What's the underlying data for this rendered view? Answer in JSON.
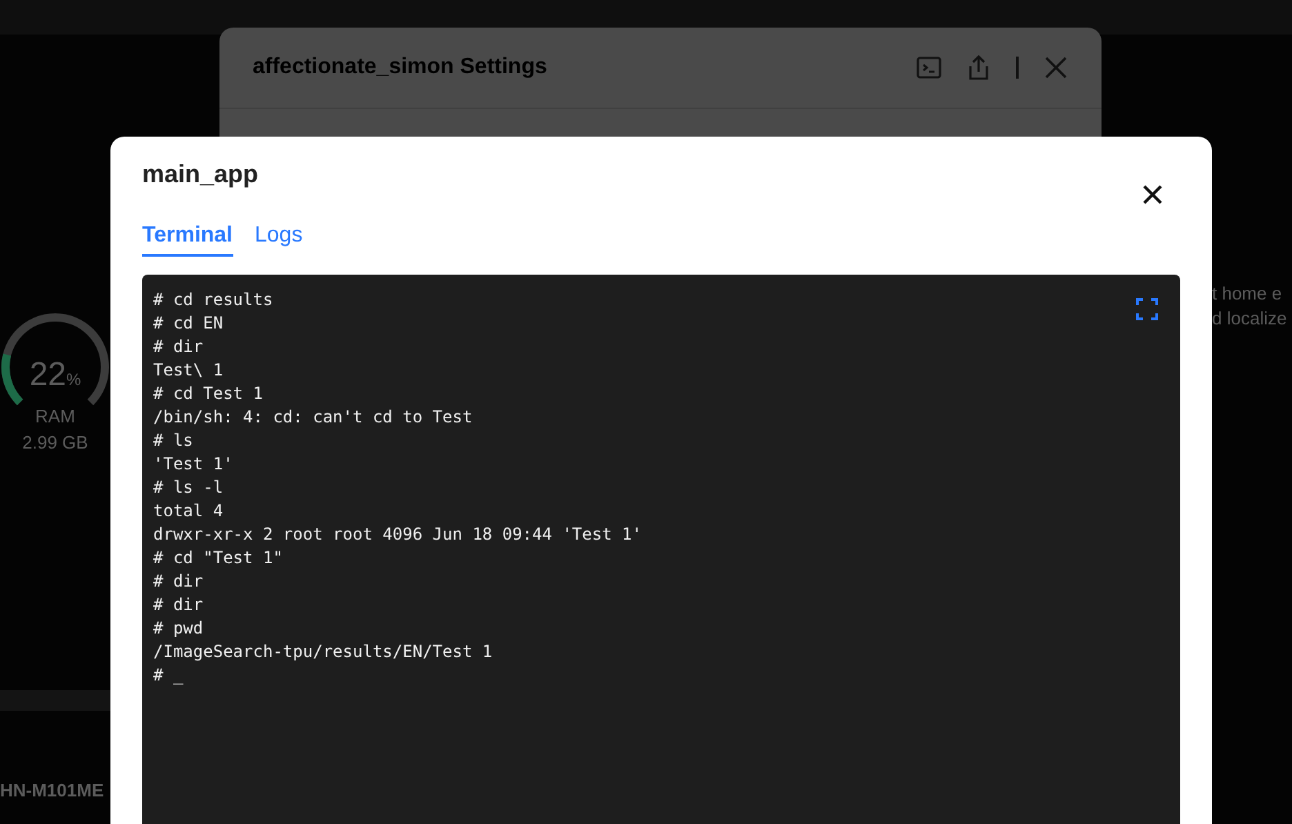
{
  "background": {
    "gauge": {
      "value": "22",
      "unit": "%",
      "label": "RAM",
      "amount": "2.99 GB"
    },
    "device_name": "HN-M101ME",
    "description_lines": [
      "t home e",
      "d localize"
    ]
  },
  "settings_dialog": {
    "title": "affectionate_simon Settings"
  },
  "dialog": {
    "title": "main_app",
    "tabs": [
      {
        "label": "Terminal",
        "selected": true
      },
      {
        "label": "Logs",
        "selected": false
      }
    ],
    "terminal_lines": [
      "# cd results",
      "# cd EN",
      "# dir",
      "Test\\ 1",
      "# cd Test 1",
      "/bin/sh: 4: cd: can't cd to Test",
      "# ls",
      "'Test 1'",
      "# ls -l",
      "total 4",
      "drwxr-xr-x 2 root root 4096 Jun 18 09:44 'Test 1'",
      "# cd \"Test 1\"",
      "# dir",
      "# dir",
      "# pwd",
      "/ImageSearch-tpu/results/EN/Test 1",
      "# _"
    ]
  }
}
